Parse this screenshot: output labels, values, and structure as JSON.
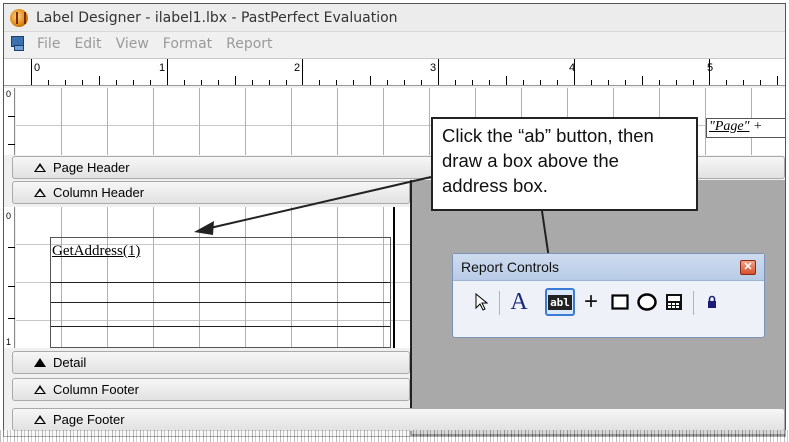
{
  "window": {
    "title": "Label Designer - ilabel1.lbx - PastPerfect Evaluation"
  },
  "menu": {
    "items": [
      "File",
      "Edit",
      "View",
      "Format",
      "Report"
    ]
  },
  "ruler": {
    "labels": [
      "0",
      "1",
      "2",
      "3",
      "4",
      "5"
    ]
  },
  "vruler": {
    "top_label": "0",
    "mid_label": "0",
    "bottom_label": "1"
  },
  "bands": {
    "page_header": "Page Header",
    "column_header": "Column Header",
    "detail": "Detail",
    "column_footer": "Column Footer",
    "page_footer": "Page Footer"
  },
  "fields": {
    "address": "GetAddress(1)",
    "page_prefix": "\"Page\"",
    "page_suffix": " + "
  },
  "callout": {
    "text": "Click the “ab” button, then draw a box above the address box."
  },
  "toolbar": {
    "title": "Report Controls",
    "close_glyph": "✕",
    "tools": {
      "pointer": "⇱",
      "label": "A",
      "field": "abl",
      "line": "+",
      "rectangle": "□",
      "ellipse": "○",
      "picture": "▦",
      "lock": "🔒"
    }
  }
}
